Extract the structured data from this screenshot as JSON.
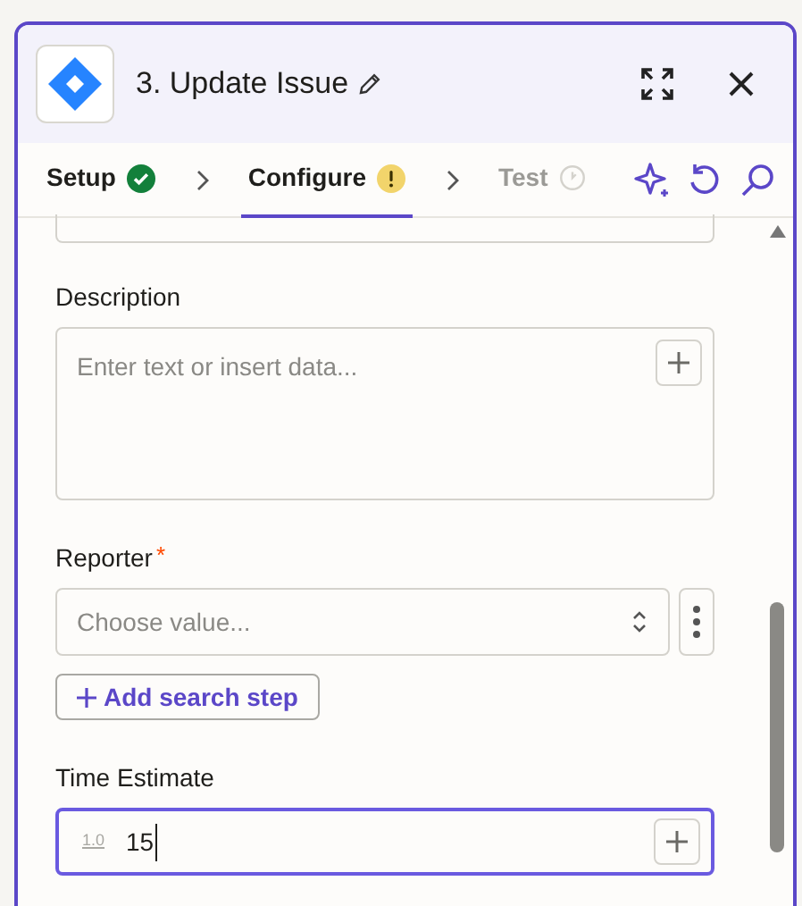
{
  "header": {
    "title": "3. Update Issue"
  },
  "tabs": [
    {
      "label": "Setup",
      "selected": false,
      "kind": "complete"
    },
    {
      "label": "Configure",
      "selected": true,
      "kind": "warning"
    },
    {
      "label": "Test",
      "selected": false,
      "kind": "pending"
    }
  ],
  "fields": [
    {
      "kind": "textarea",
      "label": "Description",
      "placeholder": "Enter text or insert data..."
    },
    {
      "kind": "select",
      "label": "Reporter",
      "required_mark": "*",
      "placeholder": "Choose value...",
      "action": "Add search step"
    },
    {
      "kind": "number",
      "label": "Time Estimate",
      "focused": true,
      "type_hint": "1.0",
      "value": "15"
    }
  ]
}
